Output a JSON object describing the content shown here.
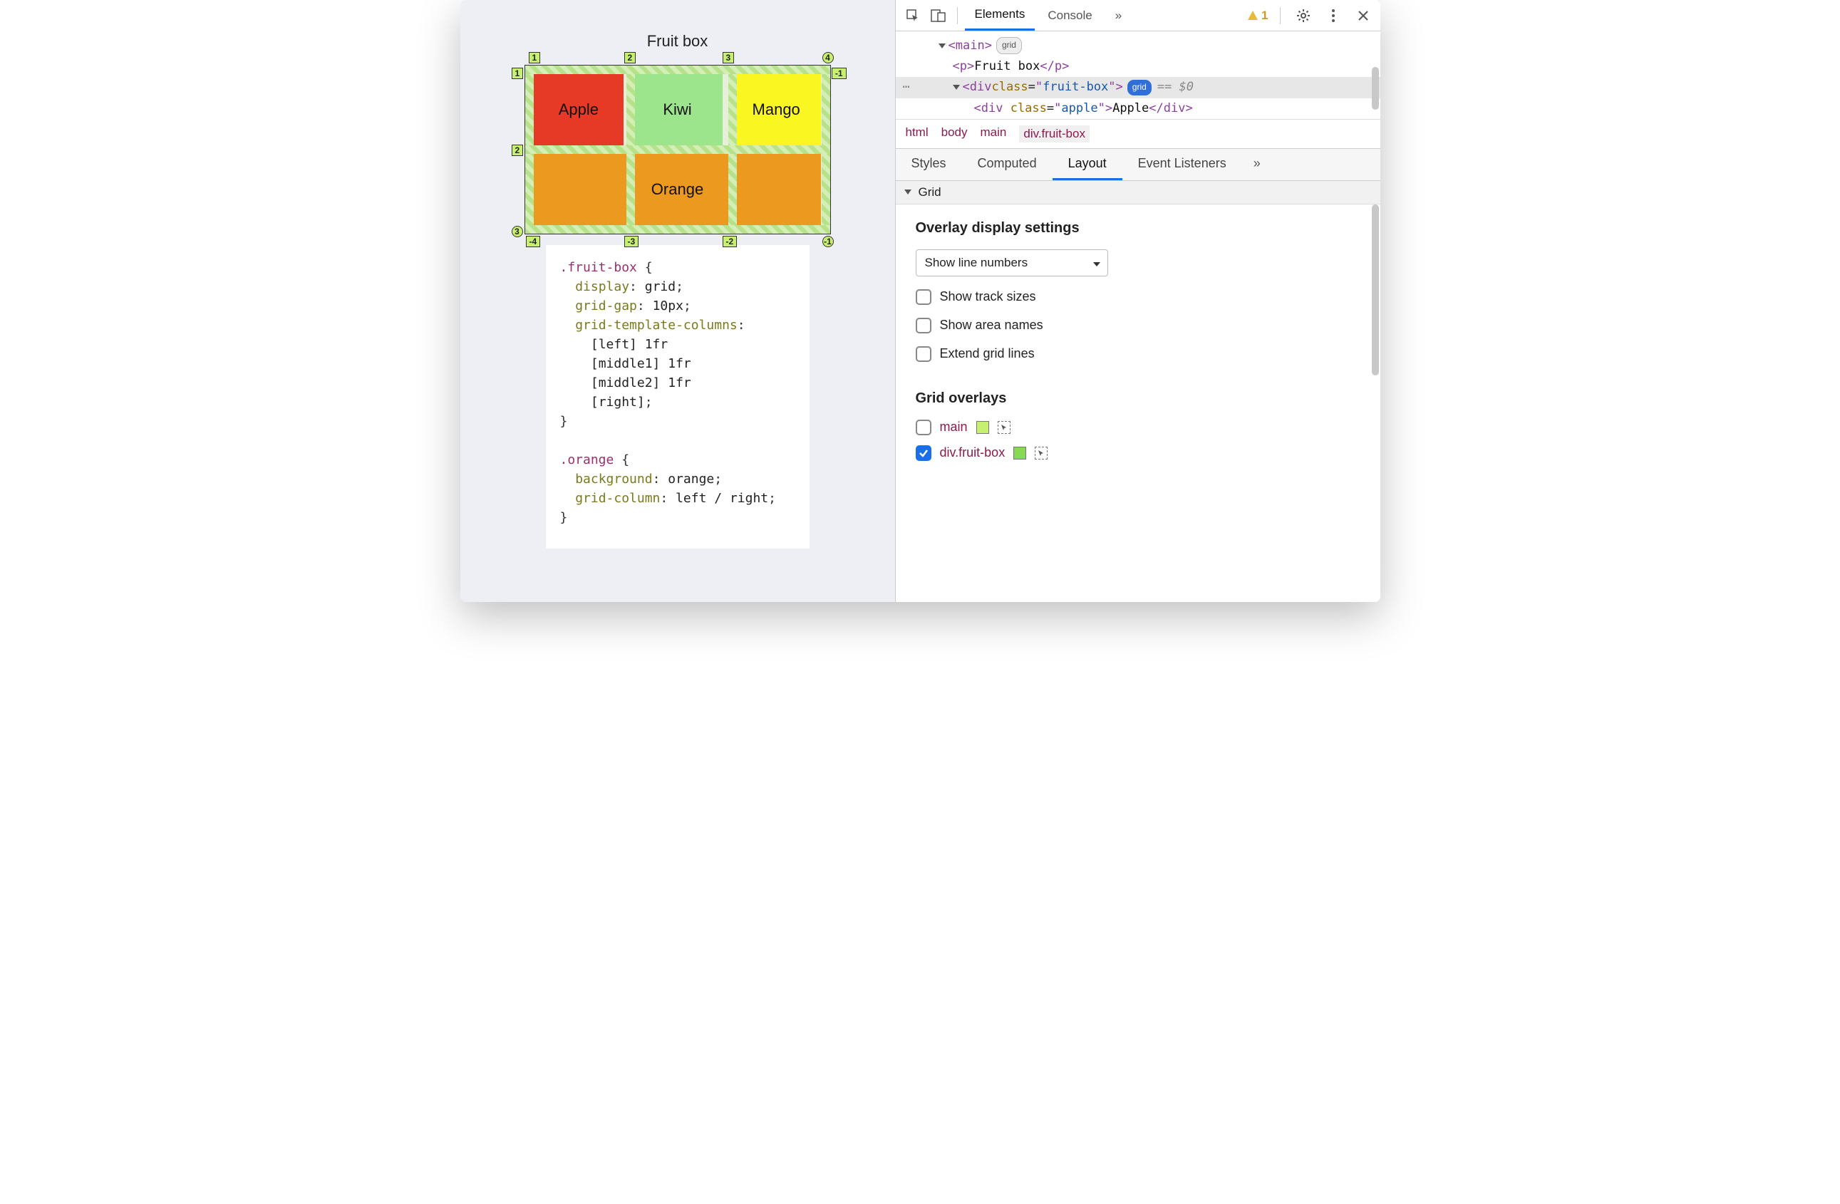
{
  "left": {
    "title": "Fruit box",
    "cells": {
      "apple": "Apple",
      "kiwi": "Kiwi",
      "mango": "Mango",
      "orange": "Orange"
    },
    "lineNumbers": {
      "topCols": [
        "1",
        "2",
        "3",
        "4"
      ],
      "leftRows": [
        "1",
        "2",
        "3"
      ],
      "bottomCols": [
        "-4",
        "-3",
        "-2",
        "-1"
      ],
      "rightRows": [
        "-1"
      ]
    },
    "css": {
      "rule1_sel": ".fruit-box",
      "rule1_props": [
        [
          "display",
          "grid"
        ],
        [
          "grid-gap",
          "10px"
        ],
        [
          "grid-template-columns",
          ""
        ],
        [
          "",
          "[left] 1fr"
        ],
        [
          "",
          "[middle1] 1fr"
        ],
        [
          "",
          "[middle2] 1fr"
        ],
        [
          "",
          "[right]"
        ]
      ],
      "rule2_sel": ".orange",
      "rule2_props": [
        [
          "background",
          "orange"
        ],
        [
          "grid-column",
          "left / right"
        ]
      ]
    }
  },
  "devtools": {
    "tabs": {
      "elements": "Elements",
      "console": "Console",
      "more": "»"
    },
    "warnings": "1",
    "dom": {
      "mainOpen": "<main>",
      "mainBadge": "grid",
      "pLine": "<p>Fruit box</p>",
      "selOpen": "<div class=\"fruit-box\">",
      "selBadge": "grid",
      "selEq": "== $0",
      "childLine": "<div class=\"apple\">Apple</div>"
    },
    "breadcrumb": [
      "html",
      "body",
      "main",
      "div.fruit-box"
    ],
    "subtabs": {
      "styles": "Styles",
      "computed": "Computed",
      "layout": "Layout",
      "events": "Event Listeners",
      "more": "»"
    },
    "gridSection": "Grid",
    "overlaySettingsTitle": "Overlay display settings",
    "lineNumbersSelect": "Show line numbers",
    "checkboxes": {
      "trackSizes": "Show track sizes",
      "areaNames": "Show area names",
      "extendLines": "Extend grid lines"
    },
    "gridOverlaysTitle": "Grid overlays",
    "overlays": [
      {
        "name": "main",
        "checked": false,
        "color": "#c7f06e"
      },
      {
        "name": "div.fruit-box",
        "checked": true,
        "color": "#86d952"
      }
    ]
  }
}
